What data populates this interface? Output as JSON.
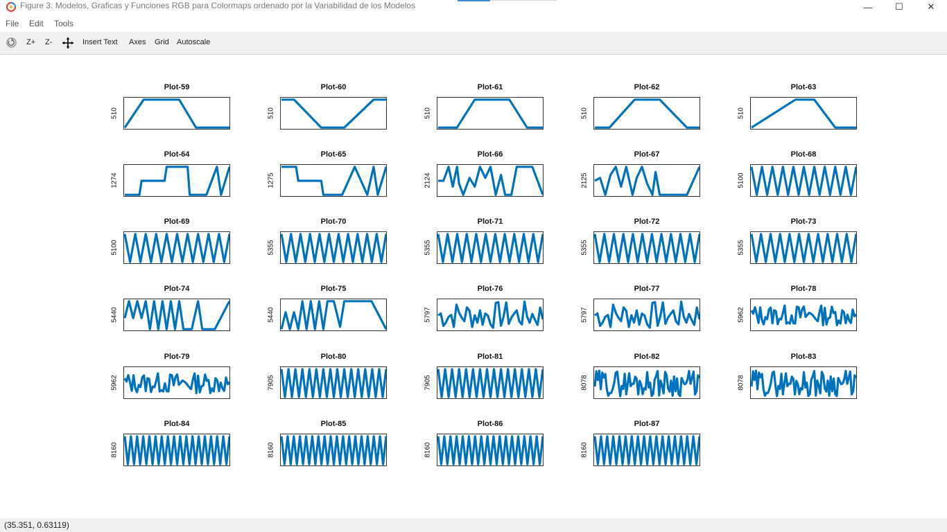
{
  "window": {
    "title": "Figure 3: Modelos, Graficas y Funciones RGB para Colormaps ordenado por la Variabilidad de los Modelos",
    "minimize_glyph": "—",
    "maximize_glyph": "☐",
    "close_glyph": "✕"
  },
  "menu": [
    "File",
    "Edit",
    "Tools"
  ],
  "toolbar": {
    "rotate_icon": "rotate-icon",
    "zoom_in": "Z+",
    "zoom_out": "Z-",
    "pan_icon": "pan-move-icon",
    "insert_text": "Insert Text",
    "axes": "Axes",
    "grid": "Grid",
    "autoscale": "Autoscale"
  },
  "status": {
    "coordinates": "(35.351, 0.63119)"
  },
  "colors": {
    "line": "#0072bd",
    "accent": "#3a8ad6"
  },
  "plots": [
    {
      "title": "Plot-59",
      "ylabel": "510",
      "pattern": "p59"
    },
    {
      "title": "Plot-60",
      "ylabel": "510",
      "pattern": "p60"
    },
    {
      "title": "Plot-61",
      "ylabel": "510",
      "pattern": "p61"
    },
    {
      "title": "Plot-62",
      "ylabel": "510",
      "pattern": "p62"
    },
    {
      "title": "Plot-63",
      "ylabel": "510",
      "pattern": "p63"
    },
    {
      "title": "Plot-64",
      "ylabel": "1274",
      "pattern": "p64"
    },
    {
      "title": "Plot-65",
      "ylabel": "1275",
      "pattern": "p65"
    },
    {
      "title": "Plot-66",
      "ylabel": "2124",
      "pattern": "p66"
    },
    {
      "title": "Plot-67",
      "ylabel": "2125",
      "pattern": "p67"
    },
    {
      "title": "Plot-68",
      "ylabel": "5100",
      "pattern": "saw10"
    },
    {
      "title": "Plot-69",
      "ylabel": "5100",
      "pattern": "saw10"
    },
    {
      "title": "Plot-70",
      "ylabel": "5355",
      "pattern": "saw11"
    },
    {
      "title": "Plot-71",
      "ylabel": "5355",
      "pattern": "saw11"
    },
    {
      "title": "Plot-72",
      "ylabel": "5355",
      "pattern": "saw11"
    },
    {
      "title": "Plot-73",
      "ylabel": "5355",
      "pattern": "saw11"
    },
    {
      "title": "Plot-74",
      "ylabel": "5440",
      "pattern": "p74"
    },
    {
      "title": "Plot-75",
      "ylabel": "5440",
      "pattern": "p75"
    },
    {
      "title": "Plot-76",
      "ylabel": "5797",
      "pattern": "wavy"
    },
    {
      "title": "Plot-77",
      "ylabel": "5797",
      "pattern": "wavy"
    },
    {
      "title": "Plot-78",
      "ylabel": "5962",
      "pattern": "noisy"
    },
    {
      "title": "Plot-79",
      "ylabel": "5962",
      "pattern": "noisy"
    },
    {
      "title": "Plot-80",
      "ylabel": "7905",
      "pattern": "saw15"
    },
    {
      "title": "Plot-81",
      "ylabel": "7905",
      "pattern": "saw15"
    },
    {
      "title": "Plot-82",
      "ylabel": "8078",
      "pattern": "noisy2"
    },
    {
      "title": "Plot-83",
      "ylabel": "8078",
      "pattern": "noisy2"
    },
    {
      "title": "Plot-84",
      "ylabel": "8160",
      "pattern": "saw16"
    },
    {
      "title": "Plot-85",
      "ylabel": "8160",
      "pattern": "saw16"
    },
    {
      "title": "Plot-86",
      "ylabel": "8160",
      "pattern": "saw16"
    },
    {
      "title": "Plot-87",
      "ylabel": "8160",
      "pattern": "saw16"
    }
  ]
}
